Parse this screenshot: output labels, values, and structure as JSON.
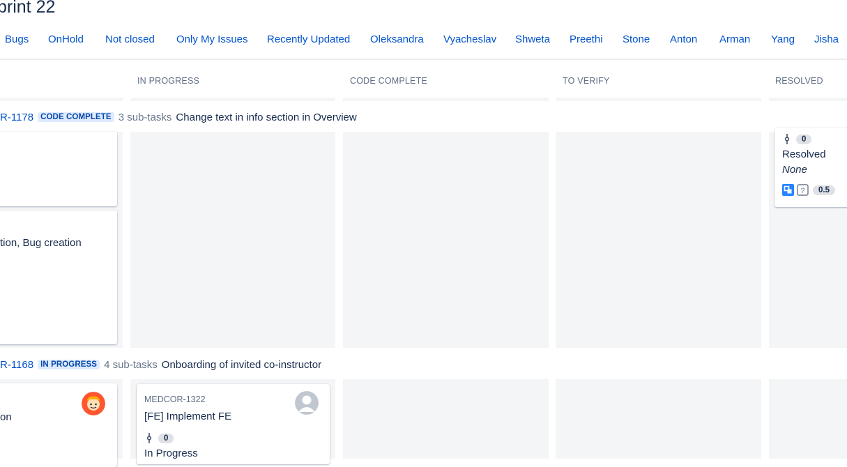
{
  "board": {
    "title": "print 22"
  },
  "quick_filters": [
    "Bugs",
    "OnHold",
    "Not closed",
    "Only My Issues",
    "Recently Updated",
    "Oleksandra",
    "Vyacheslav",
    "Shweta",
    "Preethi",
    "Stone",
    "Anton",
    "Arman",
    "Yang",
    "Jisha"
  ],
  "columns": [
    "IN PROGRESS",
    "CODE COMPLETE",
    "TO VERIFY",
    "RESOLVED"
  ],
  "swimlanes": [
    {
      "key": "R-1178",
      "status": "CODE COMPLETE",
      "subtasks": "3 sub-tasks",
      "summary": "Change text in info section in Overview"
    },
    {
      "key": "R-1168",
      "status": "IN PROGRESS",
      "subtasks": "4 sub-tasks",
      "summary": "Onboarding of invited co-instructor"
    }
  ],
  "cards": {
    "lane1_todo_second": {
      "text": "tion, Bug creation"
    },
    "lane1_resolved": {
      "pr_count": "0",
      "status": "Resolved",
      "assignee": "None",
      "estimate": "0.5"
    },
    "lane2_todo": {
      "text": "on"
    },
    "lane2_inprogress": {
      "key": "MEDCOR-1322",
      "summary": "[FE] Implement FE",
      "pr_count": "0",
      "status": "In Progress"
    }
  },
  "colors": {
    "link": "#0052cc",
    "lozenge_bg": "#deebff",
    "lozenge_text": "#0747a6",
    "lane_bg": "#f4f5f7"
  }
}
